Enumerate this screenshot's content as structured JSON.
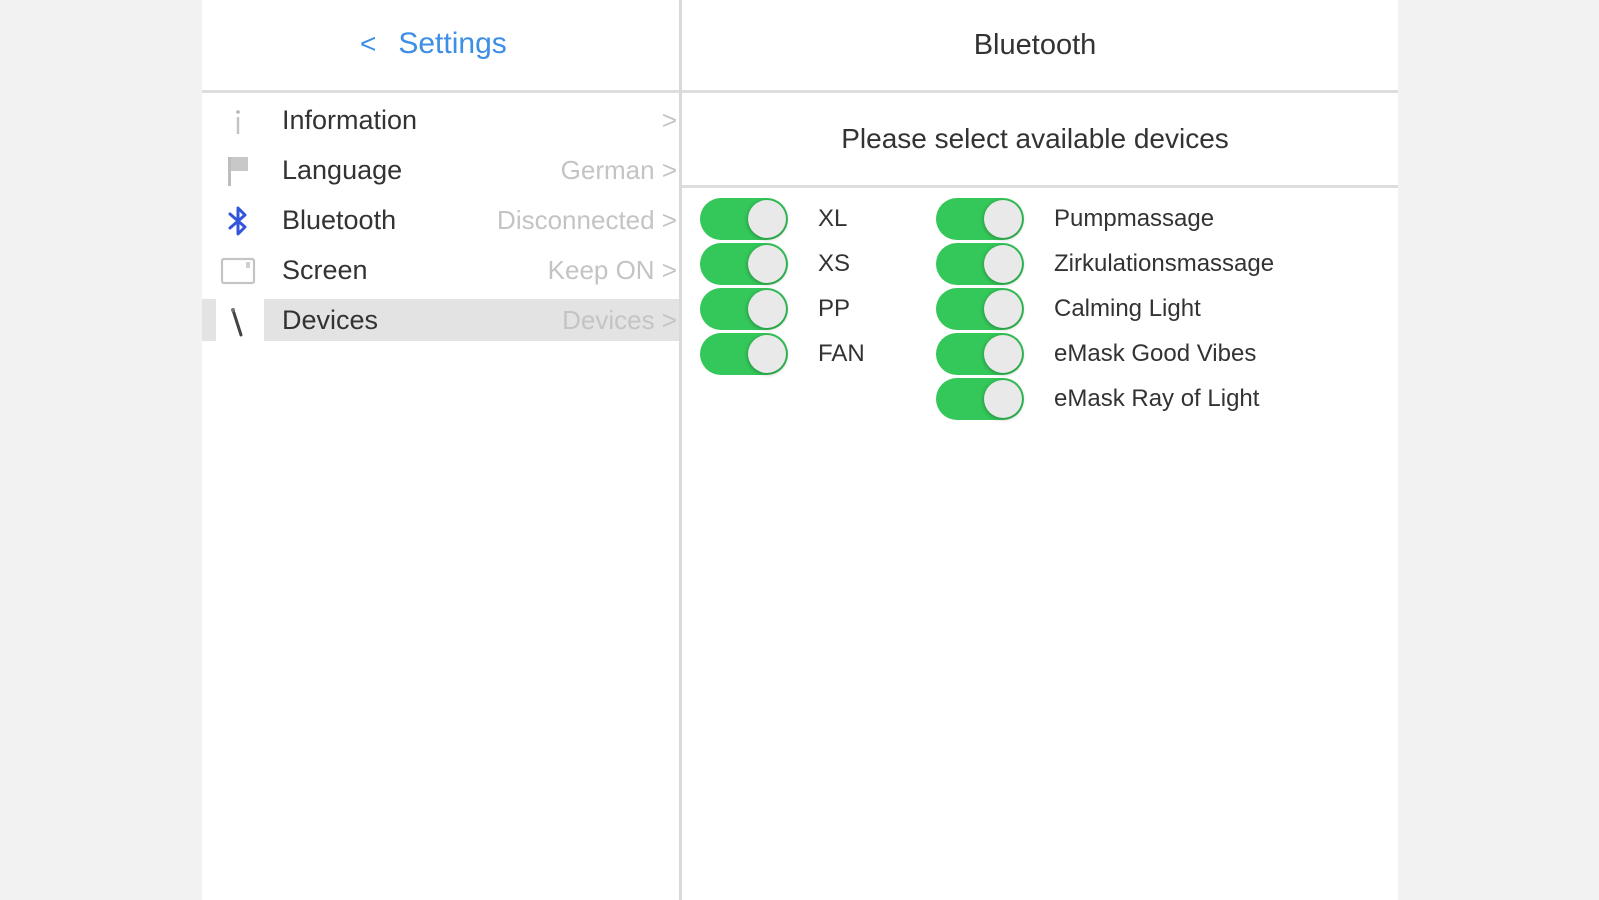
{
  "colors": {
    "accent": "#3d8ee6",
    "toggle_on": "#34c759",
    "bluetooth_icon": "#3355dd",
    "active_row": "#e3e3e3"
  },
  "left": {
    "back_icon": "chevron-left-icon",
    "back_chevron": "<",
    "back_label": "Settings",
    "items": [
      {
        "id": "information",
        "icon": "info-icon",
        "label": "Information",
        "value": ">",
        "active": false
      },
      {
        "id": "language",
        "icon": "flag-icon",
        "label": "Language",
        "value": "German >",
        "active": false
      },
      {
        "id": "bluetooth",
        "icon": "bluetooth-icon",
        "label": "Bluetooth",
        "value": "Disconnected >",
        "active": false
      },
      {
        "id": "screen",
        "icon": "screen-icon",
        "label": "Screen",
        "value": "Keep ON >",
        "active": false
      },
      {
        "id": "devices",
        "icon": "devices-icon",
        "label": "Devices",
        "value": "Devices >",
        "active": true
      }
    ]
  },
  "right": {
    "title": "Bluetooth",
    "subheader": "Please select available devices",
    "devices_left": [
      {
        "label": "XL",
        "on": true
      },
      {
        "label": "XS",
        "on": true
      },
      {
        "label": "PP",
        "on": true
      },
      {
        "label": "FAN",
        "on": true
      }
    ],
    "devices_right": [
      {
        "label": "Pumpmassage",
        "on": true
      },
      {
        "label": "Zirkulationsmassage",
        "on": true
      },
      {
        "label": "Calming Light",
        "on": true
      },
      {
        "label": "eMask Good Vibes",
        "on": true
      },
      {
        "label": "eMask Ray of Light",
        "on": true
      }
    ]
  }
}
